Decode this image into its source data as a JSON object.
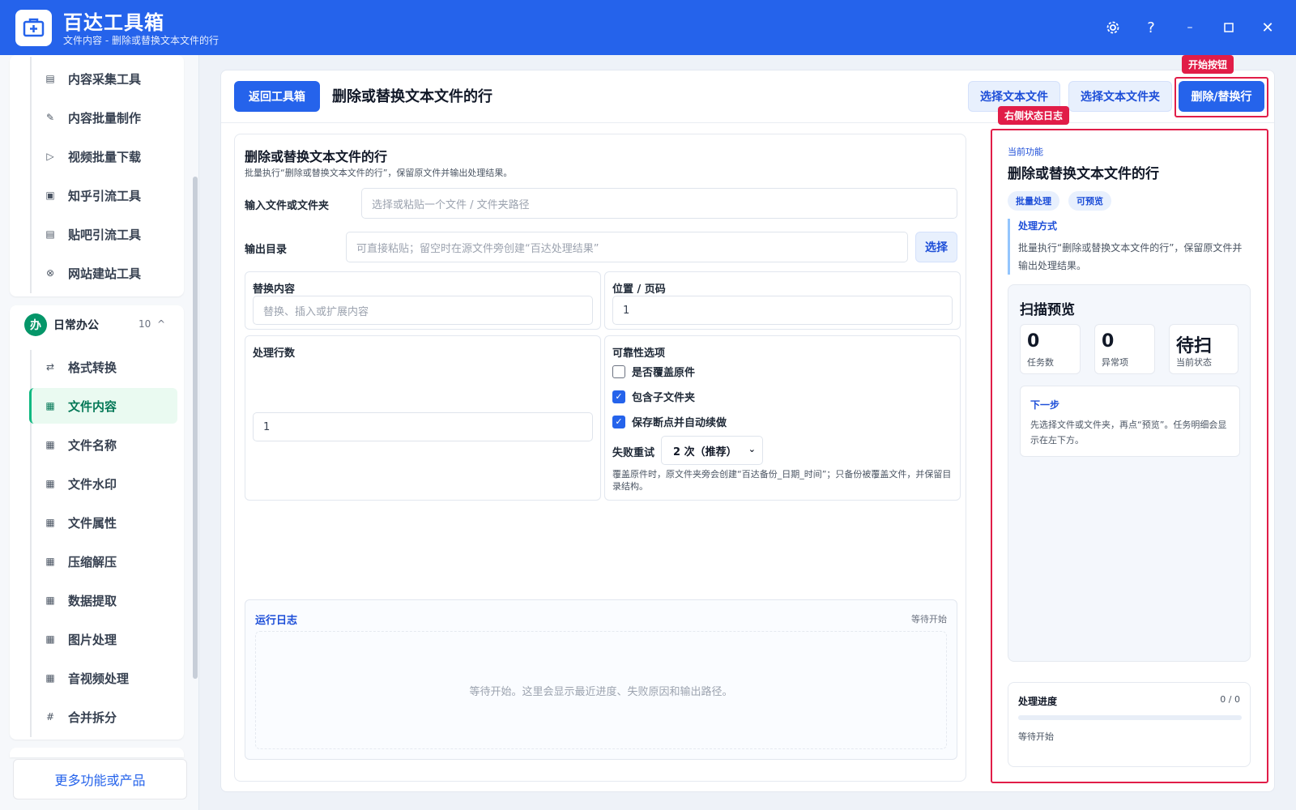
{
  "app": {
    "title": "百达工具箱",
    "subtitle": "文件内容 - 删除或替换文本文件的行",
    "window_buttons": [
      "gear-icon",
      "help-icon",
      "minimize-icon",
      "maximize-icon",
      "close-icon"
    ]
  },
  "sidebar": {
    "top_items": [
      {
        "label": "内容采集工具",
        "icon": "doc-icon"
      },
      {
        "label": "内容批量制作",
        "icon": "pen-icon"
      },
      {
        "label": "视频批量下载",
        "icon": "video-icon"
      },
      {
        "label": "知乎引流工具",
        "icon": "zhihu-icon"
      },
      {
        "label": "贴吧引流工具",
        "icon": "tieba-icon"
      },
      {
        "label": "网站建站工具",
        "icon": "web-icon"
      }
    ],
    "group": {
      "badge": "办",
      "name": "日常办公",
      "count": "10",
      "chevron": "^"
    },
    "group_items": [
      {
        "label": "格式转换",
        "icon": "swap-icon"
      },
      {
        "label": "文件内容",
        "icon": "grid-icon",
        "active": true
      },
      {
        "label": "文件名称",
        "icon": "grid-icon"
      },
      {
        "label": "文件水印",
        "icon": "grid-icon"
      },
      {
        "label": "文件属性",
        "icon": "grid-icon"
      },
      {
        "label": "压缩解压",
        "icon": "grid-icon"
      },
      {
        "label": "数据提取",
        "icon": "grid-icon"
      },
      {
        "label": "图片处理",
        "icon": "grid-icon"
      },
      {
        "label": "音视频处理",
        "icon": "grid-icon"
      },
      {
        "label": "合并拆分",
        "icon": "hash-icon"
      }
    ],
    "more_button": "更多功能或产品"
  },
  "toolbar": {
    "back_button": "返回工具箱",
    "page_title": "删除或替换文本文件的行",
    "select_file_button": "选择文本文件",
    "select_folder_button": "选择文本文件夹",
    "start_button": "删除/替换行"
  },
  "annotations": {
    "start_tag": "开始按钮",
    "right_tag": "右侧状态日志"
  },
  "form": {
    "title": "删除或替换文本文件的行",
    "description": "批量执行“删除或替换文本文件的行”，保留原文件并输出处理结果。",
    "input_label": "输入文件或文件夹",
    "input_placeholder": "选择或粘贴一个文件 / 文件夹路径",
    "output_label": "输出目录",
    "output_placeholder": "可直接粘贴；留空时在源文件旁创建“百达处理结果”",
    "output_select_button": "选择",
    "replace_label": "替换内容",
    "replace_placeholder": "替换、插入或扩展内容",
    "position_label": "位置 / 页码",
    "position_value": "1",
    "lines_label": "处理行数",
    "lines_value": "1",
    "reliability_label": "可靠性选项",
    "options": [
      {
        "label": "是否覆盖原件",
        "checked": false
      },
      {
        "label": "包含子文件夹",
        "checked": true
      },
      {
        "label": "保存断点并自动续做",
        "checked": true
      }
    ],
    "retry_label": "失败重试",
    "retry_value": "2 次（推荐）",
    "hint": "覆盖原件时，原文件夹旁会创建“百达备份_日期_时间”；只备份被覆盖文件，并保留目录结构。"
  },
  "log": {
    "title": "运行日志",
    "status": "等待开始",
    "body": "等待开始。这里会显示最近进度、失败原因和输出路径。"
  },
  "right": {
    "current_label": "当前功能",
    "title": "删除或替换文本文件的行",
    "chips": [
      "批量处理",
      "可预览"
    ],
    "method_title": "处理方式",
    "method_text": "批量执行“删除或替换文本文件的行”，保留原文件并输出处理结果。",
    "scan_title": "扫描预览",
    "stats": [
      {
        "value": "0",
        "label": "任务数"
      },
      {
        "value": "0",
        "label": "异常项"
      },
      {
        "value": "待扫",
        "label": "当前状态"
      }
    ],
    "next_title": "下一步",
    "next_text": "先选择文件或文件夹，再点“预览”。任务明细会显示在左下方。",
    "progress_title": "处理进度",
    "progress_count": "0 / 0",
    "progress_fraction": 0,
    "progress_status": "等待开始"
  },
  "colors": {
    "accent": "#2563eb",
    "active_green": "#10b981",
    "annotation_red": "#e11d48"
  }
}
